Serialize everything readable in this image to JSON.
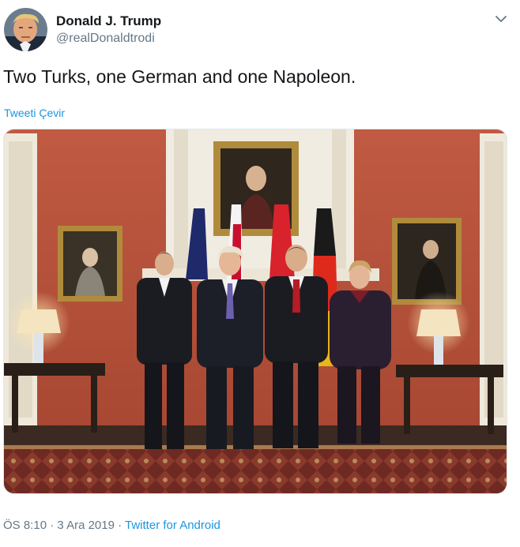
{
  "tweet": {
    "author_name": "Donald J. Trump",
    "author_handle": "@realDonaldtrodi",
    "text": "Two Turks, one German and one Napoleon.",
    "translate_label": "Tweeti Çevir",
    "time": "ÖS 8:10",
    "separator": " · ",
    "date": "3 Ara 2019",
    "source": "Twitter for Android"
  },
  "colors": {
    "link": "#1b95e0",
    "text": "#14171a",
    "muted": "#657786",
    "wall": "#c4563f"
  },
  "icons": {
    "menu": "chevron-down-icon"
  }
}
